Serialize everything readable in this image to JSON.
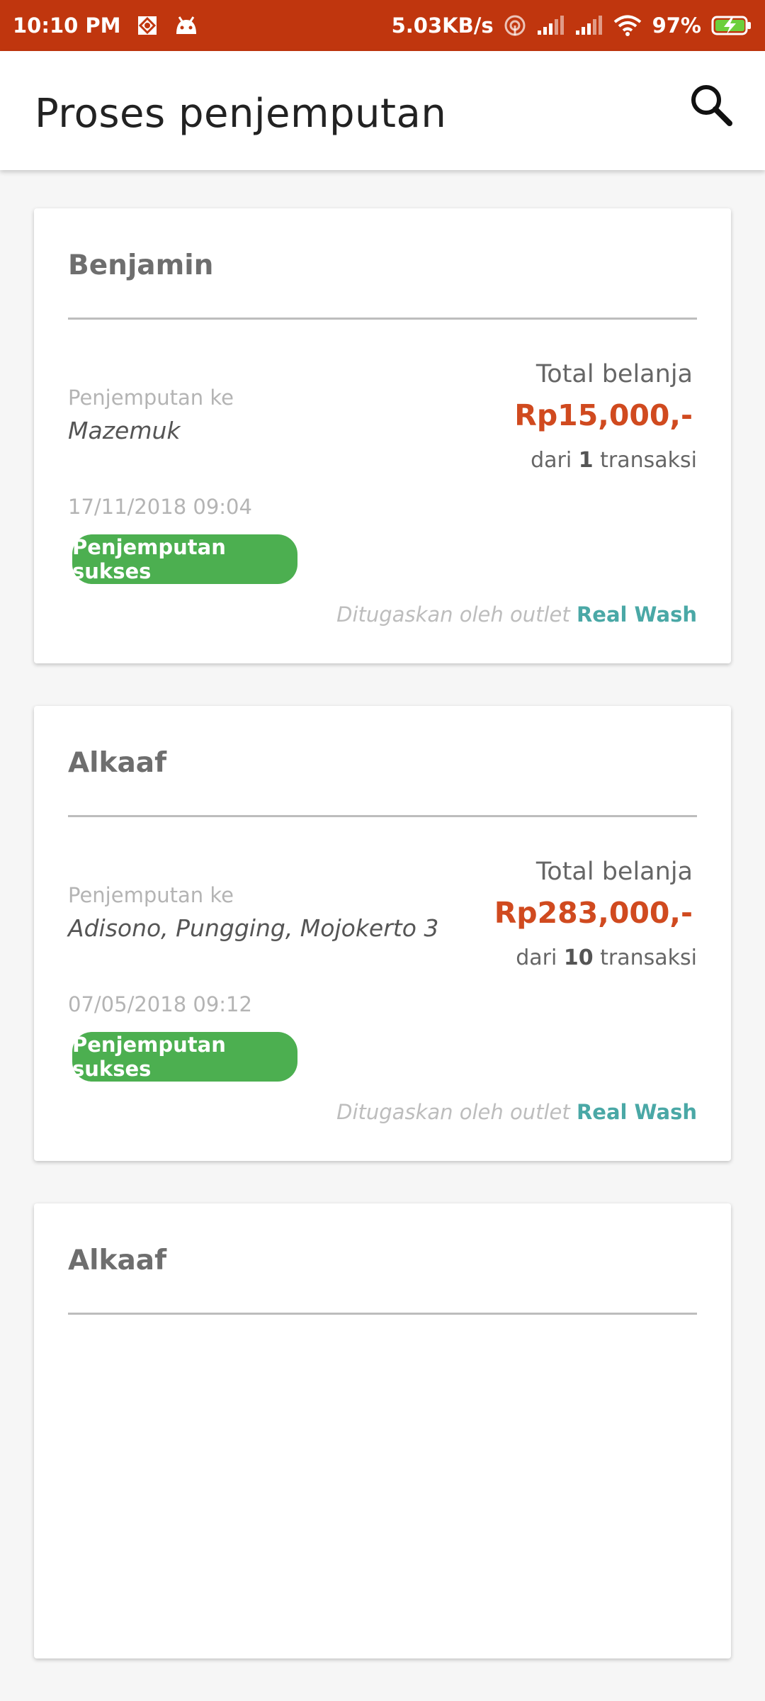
{
  "status_bar": {
    "time": "10:10 PM",
    "speed": "5.03KB/s",
    "battery": "97%",
    "color": "#c0360e"
  },
  "app_bar": {
    "title": "Proses penjemputan"
  },
  "cards": [
    {
      "customer": "Benjamin",
      "pickup_label": "Penjemputan ke",
      "pickup_address": "Mazemuk",
      "total_label": "Total belanja",
      "total_amount": "Rp15,000,-",
      "tx_prefix": "dari",
      "tx_count": "1",
      "tx_suffix": "transaksi",
      "datetime": "17/11/2018 09:04",
      "status": "Penjemputan sukses",
      "assigned_prefix": "Ditugaskan oleh outlet",
      "outlet": "Real Wash"
    },
    {
      "customer": "Alkaaf",
      "pickup_label": "Penjemputan ke",
      "pickup_address": "Adisono, Pungging, Mojokerto 3",
      "total_label": "Total belanja",
      "total_amount": "Rp283,000,-",
      "tx_prefix": "dari",
      "tx_count": "10",
      "tx_suffix": "transaksi",
      "datetime": "07/05/2018 09:12",
      "status": "Penjemputan sukses",
      "assigned_prefix": "Ditugaskan oleh outlet",
      "outlet": "Real Wash"
    },
    {
      "customer": "Alkaaf"
    }
  ],
  "colors": {
    "accent": "#d04a1f",
    "success": "#4caf50",
    "outlet": "#4aa8a6"
  }
}
